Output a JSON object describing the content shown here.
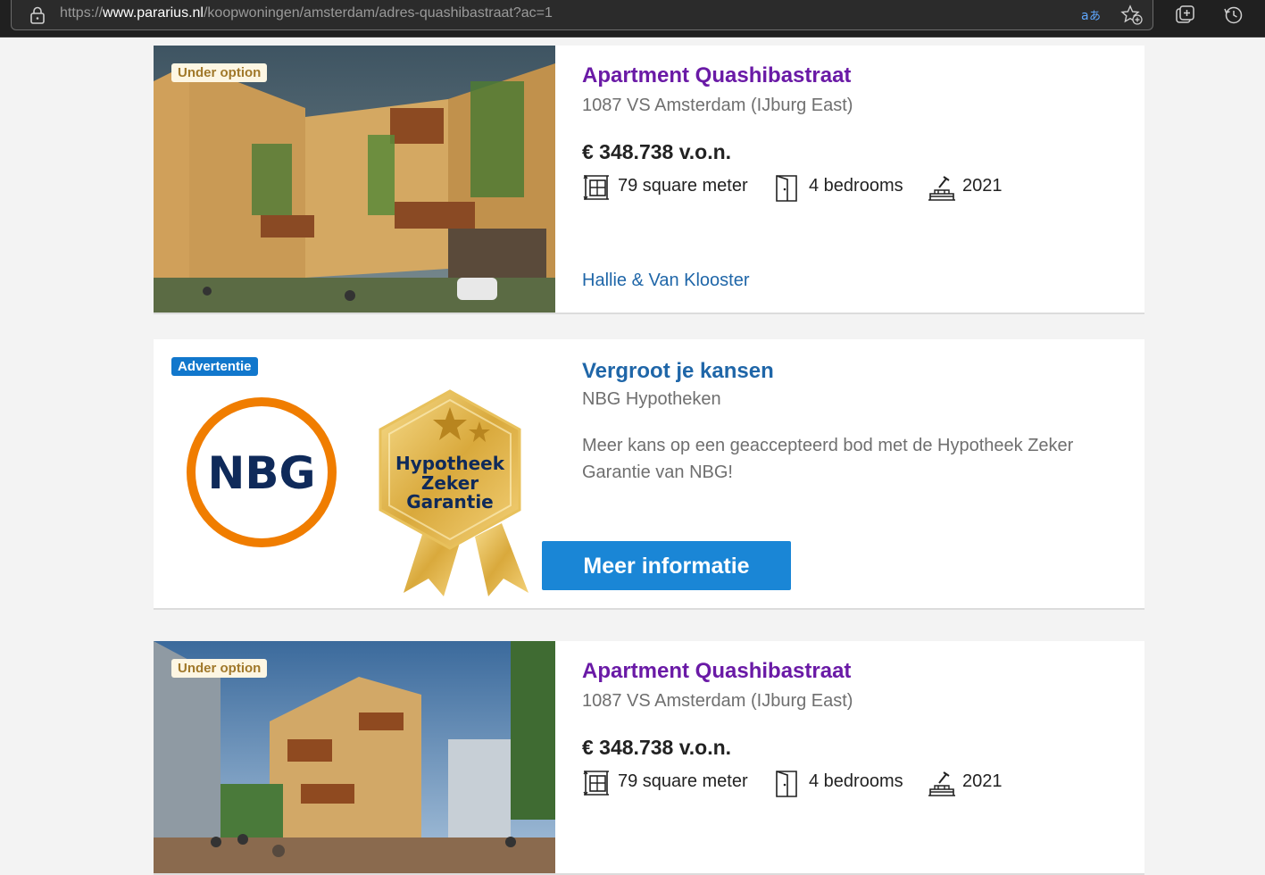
{
  "browser": {
    "url_prefix": "https://",
    "url_host": "www.pararius.nl",
    "url_path": "/koopwoningen/amsterdam/adres-quashibastraat?ac=1",
    "icons": [
      "lock-icon",
      "translate-icon",
      "favorite-add-icon",
      "collections-icon",
      "history-icon"
    ]
  },
  "listings": [
    {
      "badge": "Under option",
      "title": "Apartment Quashibastraat",
      "address": "1087 VS Amsterdam (IJburg East)",
      "price": "€ 348.738 v.o.n.",
      "area": "79 square meter",
      "bedrooms": "4 bedrooms",
      "year": "2021",
      "agent": "Hallie & Van Klooster"
    },
    {
      "badge": "Under option",
      "title": "Apartment Quashibastraat",
      "address": "1087 VS Amsterdam (IJburg East)",
      "price": "€ 348.738 v.o.n.",
      "area": "79 square meter",
      "bedrooms": "4 bedrooms",
      "year": "2021"
    }
  ],
  "ad": {
    "badge": "Advertentie",
    "title": "Vergroot je kansen",
    "advertiser": "NBG Hypotheken",
    "body": "Meer kans op een geaccepteerd bod met de Hypotheek Zeker Garantie van NBG!",
    "cta": "Meer informatie",
    "logo_text": "NBG",
    "seal_line1": "Hypotheek",
    "seal_line2": "Zeker",
    "seal_line3": "Garantie"
  },
  "colors": {
    "title_purple": "#6a1aa6",
    "link_blue": "#1f66a8",
    "cta_blue": "#1a86d6",
    "nbg_orange": "#f07d00",
    "nbg_navy": "#0f2a5a"
  }
}
